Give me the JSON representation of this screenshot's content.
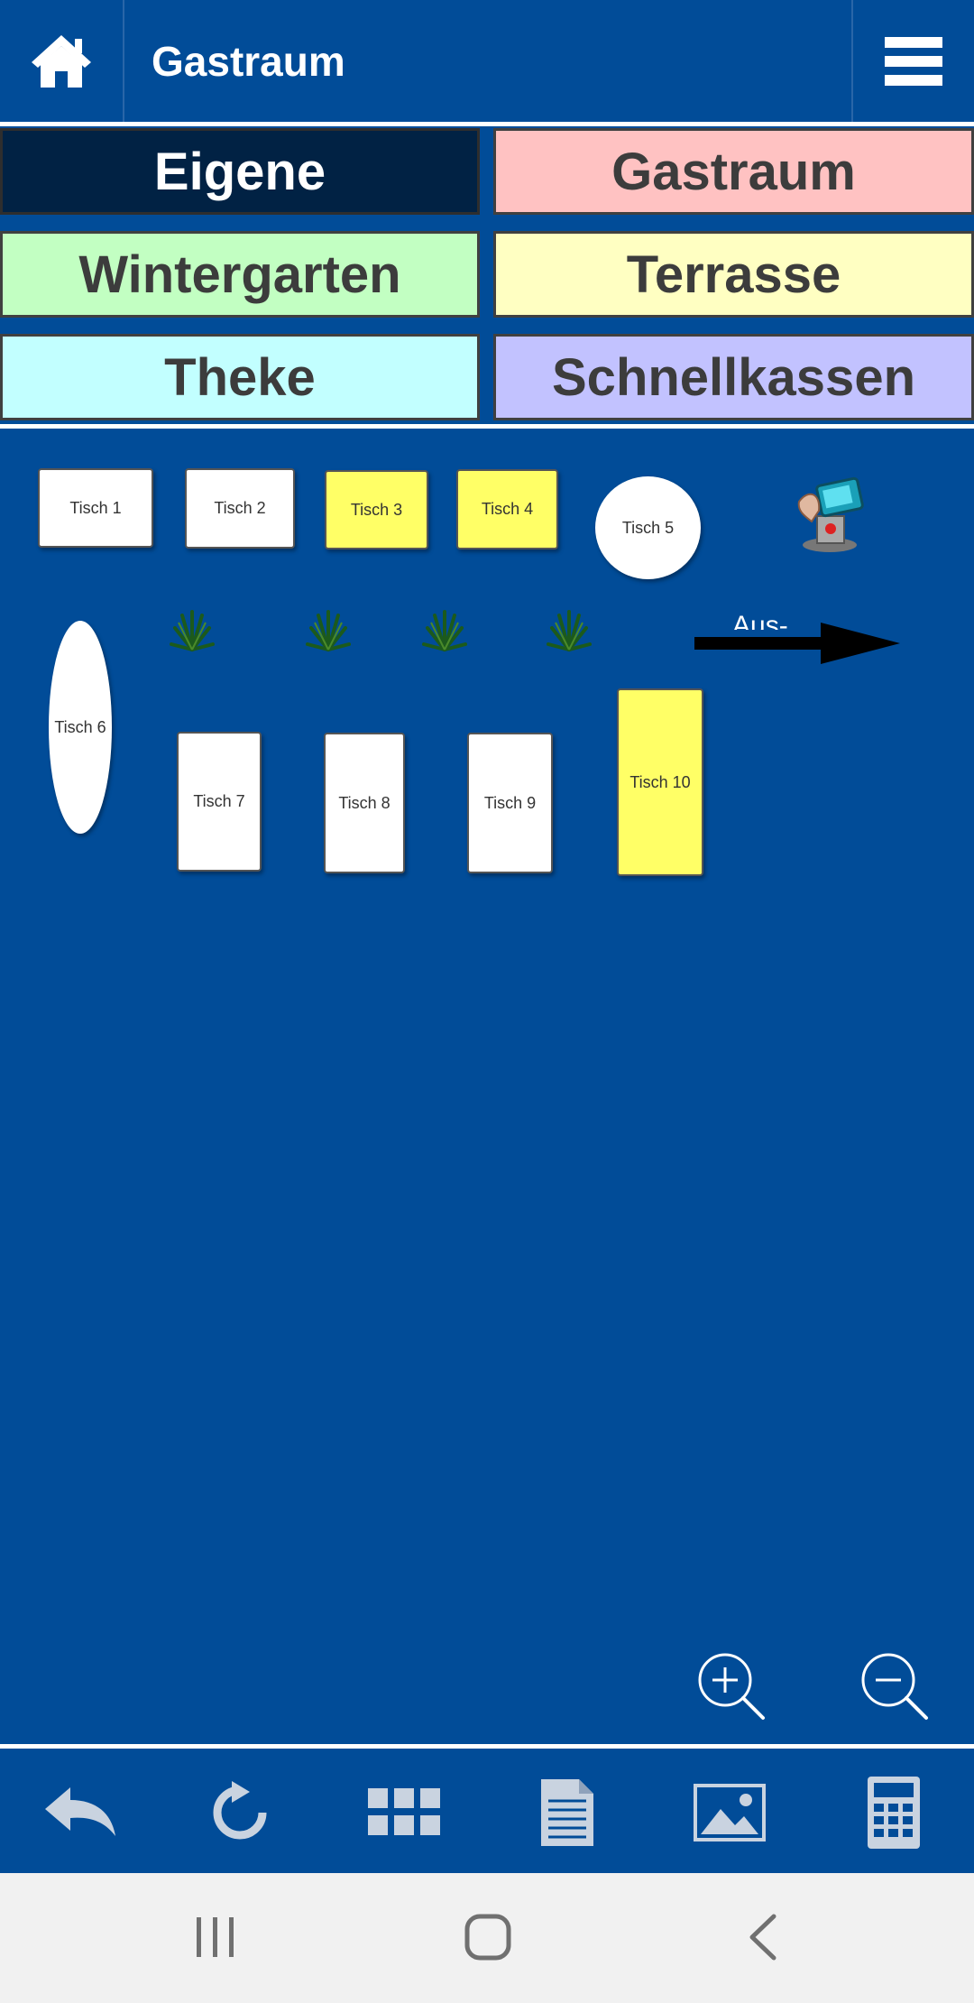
{
  "header": {
    "title": "Gastraum"
  },
  "rooms": [
    {
      "label": "Eigene",
      "color": "#012244",
      "active": true
    },
    {
      "label": "Gastraum",
      "color": "#ffc2c2",
      "active": false
    },
    {
      "label": "Wintergarten",
      "color": "#c2ffc2",
      "active": false
    },
    {
      "label": "Terrasse",
      "color": "#ffffc2",
      "active": false
    },
    {
      "label": "Theke",
      "color": "#c2ffff",
      "active": false
    },
    {
      "label": "Schnellkassen",
      "color": "#c2c2ff",
      "active": false
    }
  ],
  "tables": [
    {
      "label": "Tisch 1",
      "color": "#ffffff",
      "shape": "rect"
    },
    {
      "label": "Tisch 2",
      "color": "#ffffff",
      "shape": "rect"
    },
    {
      "label": "Tisch 3",
      "color": "#ffff66",
      "shape": "rect"
    },
    {
      "label": "Tisch 4",
      "color": "#ffff66",
      "shape": "rect"
    },
    {
      "label": "Tisch 5",
      "color": "#ffffff",
      "shape": "round"
    },
    {
      "label": "Tisch 6",
      "color": "#ffffff",
      "shape": "oval"
    },
    {
      "label": "Tisch 7",
      "color": "#ffffff",
      "shape": "rect"
    },
    {
      "label": "Tisch 8",
      "color": "#ffffff",
      "shape": "rect"
    },
    {
      "label": "Tisch 9",
      "color": "#ffffff",
      "shape": "rect"
    },
    {
      "label": "Tisch 10",
      "color": "#ffff66",
      "shape": "rect"
    }
  ],
  "exit": {
    "label": "Aus-"
  },
  "icons": {
    "home": "home-icon",
    "menu": "hamburger-menu-icon",
    "zoom_in": "zoom-in-icon",
    "zoom_out": "zoom-out-icon",
    "toolbar": [
      "undo-icon",
      "refresh-icon",
      "grid-icon",
      "document-icon",
      "image-icon",
      "calculator-icon"
    ],
    "nav": [
      "recent-apps-icon",
      "home-nav-icon",
      "back-nav-icon"
    ]
  },
  "colors": {
    "background": "#014c98",
    "navbar": "#f1f1f1"
  }
}
